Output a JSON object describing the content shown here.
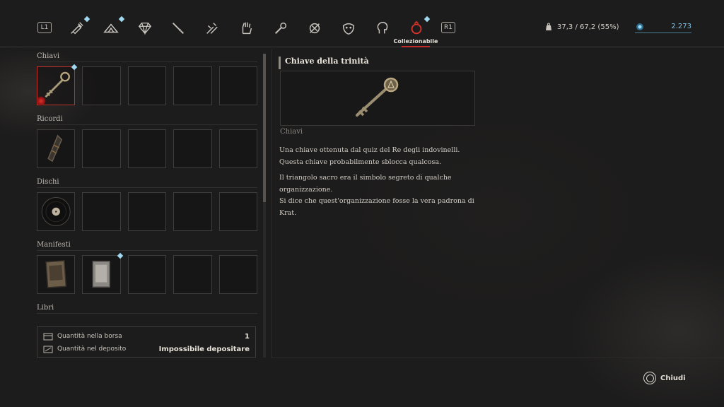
{
  "header": {
    "shoulder_left": "L1",
    "shoulder_right": "R1",
    "active_tab_label": "Collezionabile",
    "tabs": [
      {
        "icon": "syringe-icon",
        "new": true
      },
      {
        "icon": "materials-icon",
        "new": true
      },
      {
        "icon": "gem-icon",
        "new": false
      },
      {
        "icon": "weapon-icon",
        "new": false
      },
      {
        "icon": "handle-icon",
        "new": false
      },
      {
        "icon": "glove-icon",
        "new": false
      },
      {
        "icon": "wrench-icon",
        "new": false
      },
      {
        "icon": "tools-icon",
        "new": false
      },
      {
        "icon": "mask-icon",
        "new": false
      },
      {
        "icon": "head-icon",
        "new": false
      },
      {
        "icon": "collectible-icon",
        "new": true
      }
    ],
    "weight": "37,3 / 67,2 (55%)",
    "currency": "2.273"
  },
  "inventory": {
    "sections": [
      {
        "title": "Chiavi"
      },
      {
        "title": "Ricordi"
      },
      {
        "title": "Dischi"
      },
      {
        "title": "Manifesti"
      },
      {
        "title": "Libri"
      }
    ]
  },
  "quantity": {
    "bag_label": "Quantità nella borsa",
    "bag_value": "1",
    "storage_label": "Quantità nel deposito",
    "storage_value": "Impossibile depositare"
  },
  "detail": {
    "title": "Chiave della trinità",
    "category": "Chiavi",
    "paragraphs": [
      "Una chiave ottenuta dal quiz del Re degli indovinelli.",
      "Questa chiave probabilmente sblocca qualcosa.",
      "Il triangolo sacro era il simbolo segreto di qualche organizzazione.",
      "Si dice che quest'organizzazione fosse la vera padrona di Krat."
    ]
  },
  "footer": {
    "close_label": "Chiudi"
  },
  "colors": {
    "accent_red": "#c2302b",
    "new_badge": "#9fd8f0",
    "currency": "#7fc3e6"
  }
}
